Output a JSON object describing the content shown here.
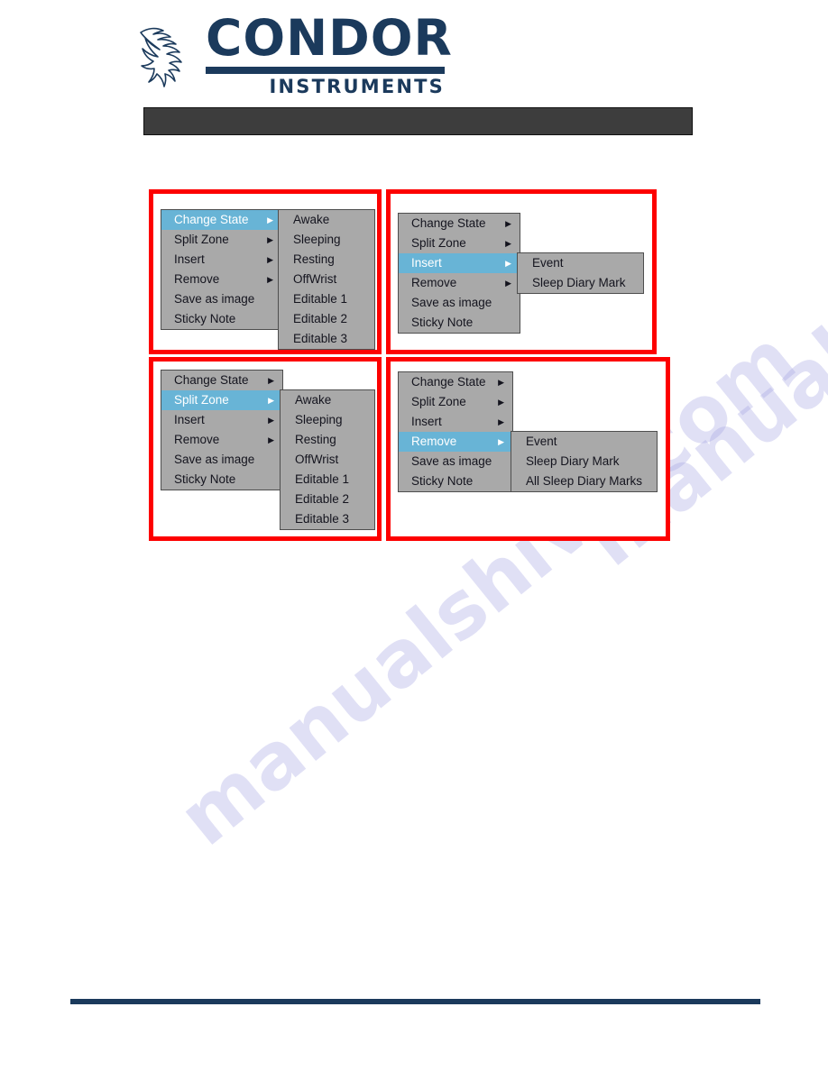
{
  "brand": {
    "name": "CONDOR",
    "subtitle": "INSTRUMENTS",
    "bird_icon": "condor-bird-icon",
    "color": "#1b3a5c"
  },
  "title_bar": {
    "text": "",
    "background": "#3d3d3d"
  },
  "watermark": {
    "text": "manualshive.com",
    "color": "#9c9ce0"
  },
  "colors": {
    "menu_background": "#a9a9a9",
    "menu_border": "#4e4e4e",
    "highlight": "#68b4d6",
    "highlight_text": "#ffffff",
    "panel_border": "#fd0000",
    "footer_rule": "#1b3a5c"
  },
  "icons": {
    "submenu_arrow": "chevron-right-icon"
  },
  "main_menu_items": [
    {
      "label": "Change State",
      "has_submenu": true
    },
    {
      "label": "Split Zone",
      "has_submenu": true
    },
    {
      "label": "Insert",
      "has_submenu": true
    },
    {
      "label": "Remove",
      "has_submenu": true
    },
    {
      "label": "Save as image",
      "has_submenu": false
    },
    {
      "label": "Sticky Note",
      "has_submenu": false
    }
  ],
  "panels": [
    {
      "id": "panel-change-state",
      "selected_index": 0,
      "selected_label": "Change State",
      "menu": [
        {
          "label": "Change State",
          "has_submenu": true,
          "selected": true
        },
        {
          "label": "Split Zone",
          "has_submenu": true,
          "selected": false
        },
        {
          "label": "Insert",
          "has_submenu": true,
          "selected": false
        },
        {
          "label": "Remove",
          "has_submenu": true,
          "selected": false
        },
        {
          "label": "Save as image",
          "has_submenu": false,
          "selected": false
        },
        {
          "label": "Sticky Note",
          "has_submenu": false,
          "selected": false
        }
      ],
      "submenu": [
        {
          "label": "Awake"
        },
        {
          "label": "Sleeping"
        },
        {
          "label": "Resting"
        },
        {
          "label": "OffWrist"
        },
        {
          "label": "Editable 1"
        },
        {
          "label": "Editable 2"
        },
        {
          "label": "Editable 3"
        }
      ]
    },
    {
      "id": "panel-insert",
      "selected_index": 2,
      "selected_label": "Insert",
      "menu": [
        {
          "label": "Change State",
          "has_submenu": true,
          "selected": false
        },
        {
          "label": "Split Zone",
          "has_submenu": true,
          "selected": false
        },
        {
          "label": "Insert",
          "has_submenu": true,
          "selected": true
        },
        {
          "label": "Remove",
          "has_submenu": true,
          "selected": false
        },
        {
          "label": "Save as image",
          "has_submenu": false,
          "selected": false
        },
        {
          "label": "Sticky Note",
          "has_submenu": false,
          "selected": false
        }
      ],
      "submenu": [
        {
          "label": "Event"
        },
        {
          "label": "Sleep Diary Mark"
        }
      ]
    },
    {
      "id": "panel-split-zone",
      "selected_index": 1,
      "selected_label": "Split Zone",
      "menu": [
        {
          "label": "Change State",
          "has_submenu": true,
          "selected": false
        },
        {
          "label": "Split Zone",
          "has_submenu": true,
          "selected": true
        },
        {
          "label": "Insert",
          "has_submenu": true,
          "selected": false
        },
        {
          "label": "Remove",
          "has_submenu": true,
          "selected": false
        },
        {
          "label": "Save as image",
          "has_submenu": false,
          "selected": false
        },
        {
          "label": "Sticky Note",
          "has_submenu": false,
          "selected": false
        }
      ],
      "submenu": [
        {
          "label": "Awake"
        },
        {
          "label": "Sleeping"
        },
        {
          "label": "Resting"
        },
        {
          "label": "OffWrist"
        },
        {
          "label": "Editable 1"
        },
        {
          "label": "Editable 2"
        },
        {
          "label": "Editable 3"
        }
      ]
    },
    {
      "id": "panel-remove",
      "selected_index": 3,
      "selected_label": "Remove",
      "menu": [
        {
          "label": "Change State",
          "has_submenu": true,
          "selected": false
        },
        {
          "label": "Split Zone",
          "has_submenu": true,
          "selected": false
        },
        {
          "label": "Insert",
          "has_submenu": true,
          "selected": false
        },
        {
          "label": "Remove",
          "has_submenu": true,
          "selected": true
        },
        {
          "label": "Save as image",
          "has_submenu": false,
          "selected": false
        },
        {
          "label": "Sticky Note",
          "has_submenu": false,
          "selected": false
        }
      ],
      "submenu": [
        {
          "label": "Event"
        },
        {
          "label": "Sleep Diary Mark"
        },
        {
          "label": "All Sleep Diary Marks"
        }
      ]
    }
  ]
}
